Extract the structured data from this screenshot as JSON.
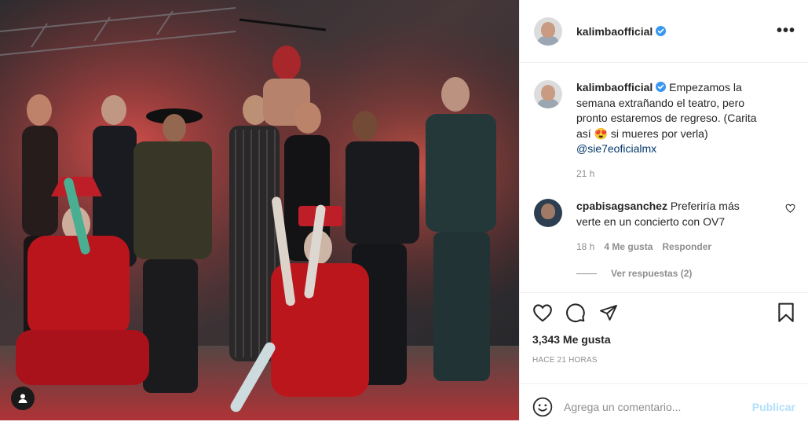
{
  "post": {
    "photo_icon": "person-tag-icon",
    "colors": {
      "link": "#00376b",
      "muted": "#8e8e8e",
      "verified": "#3897f0",
      "post_disabled": "#b2dffc"
    }
  },
  "header": {
    "username": "kalimbaofficial",
    "verified_icon": "verified-badge-icon",
    "more_label": "•••"
  },
  "caption": {
    "username": "kalimbaofficial",
    "text_before": "Empezamos la semana extrañando el teatro, pero pronto estaremos de regreso. (Carita así ",
    "emoji": "😍",
    "text_after": " si mueres por verla)",
    "mention": "@sie7eoficialmx",
    "time": "21 h"
  },
  "comment": {
    "username": "cpabisagsanchez",
    "text": "Preferiría más verte en un concierto con OV7",
    "time": "18 h",
    "likes": "4 Me gusta",
    "reply_label": "Responder",
    "view_replies": "Ver respuestas (2)"
  },
  "actions": {
    "like_icon": "heart-icon",
    "comment_icon": "comment-bubble-icon",
    "share_icon": "paper-plane-icon",
    "save_icon": "bookmark-icon",
    "likes_count": "3,343 Me gusta",
    "timestamp": "HACE 21 HORAS"
  },
  "add_comment": {
    "emoji_icon": "smiley-icon",
    "placeholder": "Agrega un comentario...",
    "post_label": "Publicar"
  }
}
